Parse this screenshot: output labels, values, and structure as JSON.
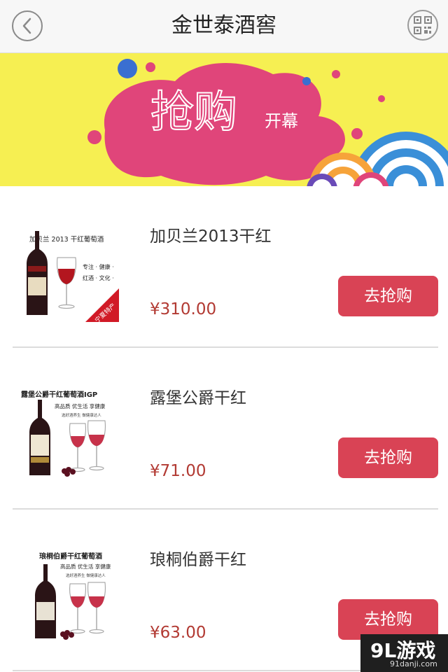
{
  "header": {
    "title": "金世泰酒窖",
    "back_icon": "chevron-left-icon",
    "qr_icon": "qr-code-icon"
  },
  "banner": {
    "headline": "抢购",
    "sub": "开幕"
  },
  "products": [
    {
      "name": "加贝兰2013干红",
      "price": "¥310.00",
      "button": "去抢购",
      "thumb": {
        "title": "加贝兰 2013 干红葡萄酒",
        "line1": "专注 · 健康 ·",
        "line2": "红酒 · 文化 ·",
        "tag": "宁夏特产"
      }
    },
    {
      "name": "露堡公爵干红",
      "price": "¥71.00",
      "button": "去抢购",
      "thumb": {
        "title": "露堡公爵干红葡萄酒IGP",
        "line1": "高品质  优生活  享健康",
        "line2": "选好酒养生  做健康达人"
      }
    },
    {
      "name": "琅桐伯爵干红",
      "price": "¥63.00",
      "button": "去抢购",
      "thumb": {
        "title": "琅桐伯爵干红葡萄酒",
        "line1": "高品质  优生活  享健康",
        "line2": "选好酒养生  做健康达人"
      }
    }
  ],
  "watermark": {
    "main": "9L游戏",
    "sub": "91danji.com"
  }
}
